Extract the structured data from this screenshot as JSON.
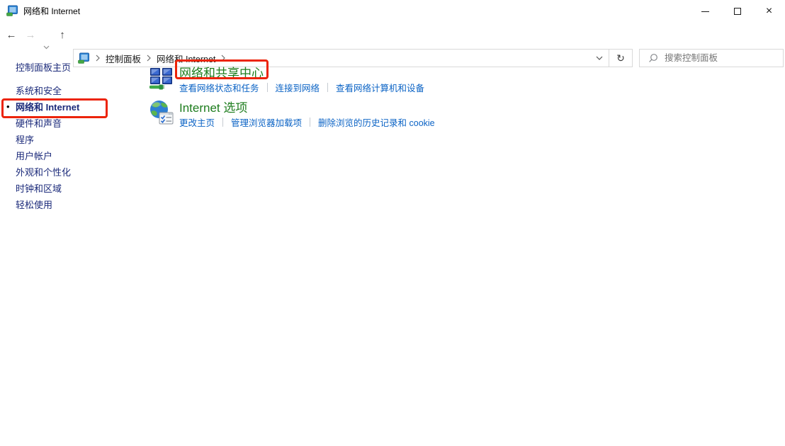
{
  "window": {
    "title": "网络和 Internet"
  },
  "icons": {
    "app_icon": "control-panel",
    "back_glyph": "←",
    "forward_glyph": "→",
    "up_glyph": "↑",
    "refresh_glyph": "↻",
    "close_glyph": "×",
    "bullet_glyph": "•",
    "minimize_icon": "horizontal-bar",
    "maximize_icon": "square-outline",
    "search_icon": "magnifier",
    "breadcrumb_separator": "chevron-right",
    "address_dropdown": "chevron-down",
    "history_dropdown": "chevron-down",
    "section_icon_1": "network-sharing-center (four blue monitors with green cable)",
    "section_icon_2": "internet-options (globe with checklist)"
  },
  "navbar": {
    "breadcrumb": {
      "crumbs": [
        {
          "label": "控制面板"
        },
        {
          "label": "网络和 Internet"
        }
      ]
    },
    "search": {
      "placeholder": "搜索控制面板"
    }
  },
  "sidebar": {
    "items": [
      {
        "label": "控制面板主页",
        "selected": false
      },
      {
        "label": "系统和安全",
        "selected": false
      },
      {
        "label": "网络和 Internet",
        "selected": true
      },
      {
        "label": "硬件和声音",
        "selected": false
      },
      {
        "label": "程序",
        "selected": false
      },
      {
        "label": "用户帐户",
        "selected": false
      },
      {
        "label": "外观和个性化",
        "selected": false
      },
      {
        "label": "时钟和区域",
        "selected": false
      },
      {
        "label": "轻松使用",
        "selected": false
      }
    ]
  },
  "main": {
    "sections": [
      {
        "title": "网络和共享中心",
        "annotated": true,
        "links": [
          "查看网络状态和任务",
          "连接到网络",
          "查看网络计算机和设备"
        ]
      },
      {
        "title": "Internet 选项",
        "annotated": false,
        "links": [
          "更改主页",
          "管理浏览器加载项",
          "删除浏览的历史记录和 cookie"
        ]
      }
    ]
  },
  "annotations": {
    "color": "#ec2409",
    "boxes": [
      "sidebar-selected-item",
      "network-sharing-center-title"
    ]
  },
  "colors": {
    "sidebar_link": "#1b2a7a",
    "section_title_green": "#1e7d1e",
    "task_link_blue": "#0b63c5",
    "annotation_red": "#ec2409",
    "border_gray": "#d9d9d9",
    "placeholder_gray": "#767676"
  }
}
